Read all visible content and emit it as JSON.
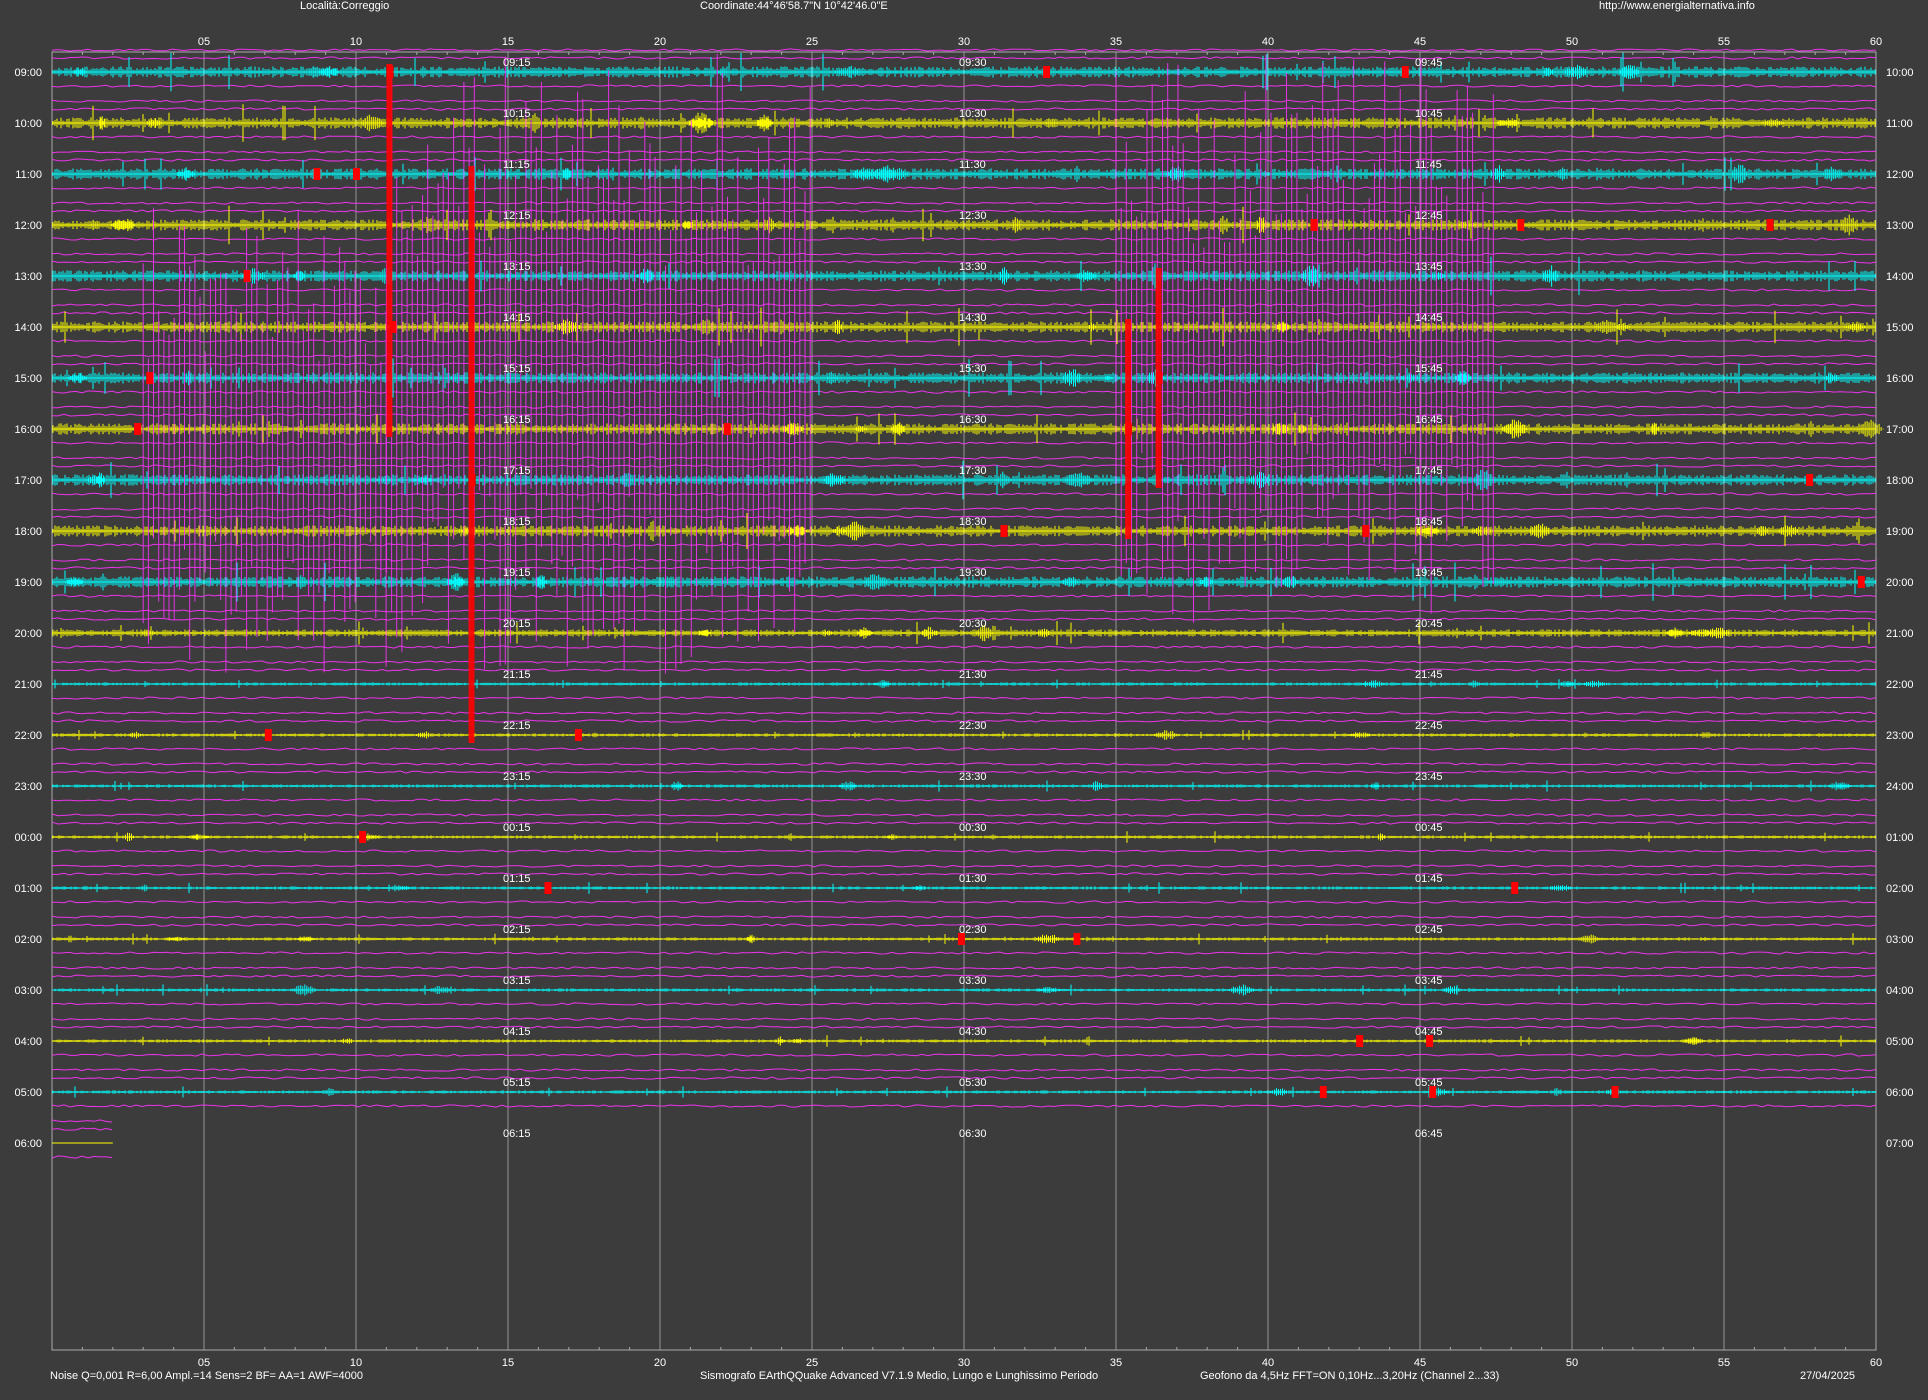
{
  "header": {
    "location": "Località:Correggio",
    "coordinates": "Coordinate:44°46'58.7\"N  10°42'46.0\"E",
    "url": "http://www.energialternativa.info"
  },
  "footer": {
    "settings": "Noise Q=0,001 R=6,00 Ampl.=14 Sens=2 BF= AA=1 AWF=4000",
    "software": "Sismografo  EArthQQuake Advanced V7.1.9  Medio, Lungo e Lunghissimo Periodo",
    "sensor": "Geofono da 4,5Hz FFT=ON 0,10Hz...3,20Hz     (Channel 2...33)",
    "date": "27/04/2025"
  },
  "colors": {
    "background": "#3c3c3c",
    "trace_a": "#00ffff",
    "trace_b": "#ffff00",
    "event": "#ff0000",
    "long_period": "#ff33ff",
    "grid": "#aaaaaa"
  },
  "chart_data": {
    "type": "line",
    "xlabel": "",
    "ylabel": "",
    "xlim": [
      0,
      60
    ],
    "x_ticks": [
      "05",
      "10",
      "15",
      "20",
      "25",
      "30",
      "35",
      "40",
      "45",
      "50",
      "55",
      "60"
    ],
    "rows": [
      {
        "left": "09:00",
        "right": "10:00",
        "marks": [
          "09:15",
          "09:30",
          "09:45"
        ],
        "trace": "a",
        "activity": 3
      },
      {
        "left": "10:00",
        "right": "11:00",
        "marks": [
          "10:15",
          "10:30",
          "10:45"
        ],
        "trace": "b",
        "activity": 3
      },
      {
        "left": "11:00",
        "right": "12:00",
        "marks": [
          "11:15",
          "11:30",
          "11:45"
        ],
        "trace": "a",
        "activity": 3
      },
      {
        "left": "12:00",
        "right": "13:00",
        "marks": [
          "12:15",
          "12:30",
          "12:45"
        ],
        "trace": "b",
        "activity": 3
      },
      {
        "left": "13:00",
        "right": "14:00",
        "marks": [
          "13:15",
          "13:30",
          "13:45"
        ],
        "trace": "a",
        "activity": 3
      },
      {
        "left": "14:00",
        "right": "15:00",
        "marks": [
          "14:15",
          "14:30",
          "14:45"
        ],
        "trace": "b",
        "activity": 3
      },
      {
        "left": "15:00",
        "right": "16:00",
        "marks": [
          "15:15",
          "15:30",
          "15:45"
        ],
        "trace": "a",
        "activity": 3
      },
      {
        "left": "16:00",
        "right": "17:00",
        "marks": [
          "16:15",
          "16:30",
          "16:45"
        ],
        "trace": "b",
        "activity": 3
      },
      {
        "left": "17:00",
        "right": "18:00",
        "marks": [
          "17:15",
          "17:30",
          "17:45"
        ],
        "trace": "a",
        "activity": 3
      },
      {
        "left": "18:00",
        "right": "19:00",
        "marks": [
          "18:15",
          "18:30",
          "18:45"
        ],
        "trace": "b",
        "activity": 3
      },
      {
        "left": "19:00",
        "right": "20:00",
        "marks": [
          "19:15",
          "19:30",
          "19:45"
        ],
        "trace": "a",
        "activity": 3
      },
      {
        "left": "20:00",
        "right": "21:00",
        "marks": [
          "20:15",
          "20:30",
          "20:45"
        ],
        "trace": "b",
        "activity": 2
      },
      {
        "left": "21:00",
        "right": "22:00",
        "marks": [
          "21:15",
          "21:30",
          "21:45"
        ],
        "trace": "a",
        "activity": 1
      },
      {
        "left": "22:00",
        "right": "23:00",
        "marks": [
          "22:15",
          "22:30",
          "22:45"
        ],
        "trace": "b",
        "activity": 1
      },
      {
        "left": "23:00",
        "right": "24:00",
        "marks": [
          "23:15",
          "23:30",
          "23:45"
        ],
        "trace": "a",
        "activity": 1
      },
      {
        "left": "00:00",
        "right": "01:00",
        "marks": [
          "00:15",
          "00:30",
          "00:45"
        ],
        "trace": "b",
        "activity": 1
      },
      {
        "left": "01:00",
        "right": "02:00",
        "marks": [
          "01:15",
          "01:30",
          "01:45"
        ],
        "trace": "a",
        "activity": 1
      },
      {
        "left": "02:00",
        "right": "03:00",
        "marks": [
          "02:15",
          "02:30",
          "02:45"
        ],
        "trace": "b",
        "activity": 1
      },
      {
        "left": "03:00",
        "right": "04:00",
        "marks": [
          "03:15",
          "03:30",
          "03:45"
        ],
        "trace": "a",
        "activity": 1
      },
      {
        "left": "04:00",
        "right": "05:00",
        "marks": [
          "04:15",
          "04:30",
          "04:45"
        ],
        "trace": "b",
        "activity": 1
      },
      {
        "left": "05:00",
        "right": "06:00",
        "marks": [
          "05:15",
          "05:30",
          "05:45"
        ],
        "trace": "a",
        "activity": 1
      },
      {
        "left": "06:00",
        "right": "07:00",
        "marks": [
          "06:15",
          "06:30",
          "06:45"
        ],
        "trace": "b",
        "activity": 0
      }
    ],
    "long_period_bursts": [
      {
        "x_start": 3,
        "x_end": 11,
        "row_start": 3,
        "row_end": 12
      },
      {
        "x_start": 11,
        "x_end": 25,
        "row_start": 0,
        "row_end": 12
      },
      {
        "x_start": 35,
        "x_end": 47.5,
        "row_start": 0,
        "row_end": 11
      }
    ],
    "event_markers": [
      {
        "x": 10,
        "row": 2
      },
      {
        "x": 11.1,
        "row": 0
      },
      {
        "x": 32.7,
        "row": 0
      },
      {
        "x": 44.5,
        "row": 0
      },
      {
        "x": 8.7,
        "row": 2
      },
      {
        "x": 6.4,
        "row": 4
      },
      {
        "x": 11.2,
        "row": 5
      },
      {
        "x": 3.2,
        "row": 6
      },
      {
        "x": 2.8,
        "row": 7
      },
      {
        "x": 22.2,
        "row": 7
      },
      {
        "x": 13.8,
        "row": 8
      },
      {
        "x": 35.4,
        "row": 7
      },
      {
        "x": 36.4,
        "row": 6
      },
      {
        "x": 41.5,
        "row": 3
      },
      {
        "x": 48.3,
        "row": 3
      },
      {
        "x": 56.5,
        "row": 3
      },
      {
        "x": 57.8,
        "row": 8
      },
      {
        "x": 59.5,
        "row": 10
      },
      {
        "x": 31.3,
        "row": 9
      },
      {
        "x": 43.2,
        "row": 9
      },
      {
        "x": 17.3,
        "row": 13
      },
      {
        "x": 7.1,
        "row": 13
      },
      {
        "x": 10.2,
        "row": 15
      },
      {
        "x": 16.3,
        "row": 16
      },
      {
        "x": 48.1,
        "row": 16
      },
      {
        "x": 29.9,
        "row": 17
      },
      {
        "x": 33.7,
        "row": 17
      },
      {
        "x": 43,
        "row": 19
      },
      {
        "x": 45.3,
        "row": 19
      },
      {
        "x": 41.8,
        "row": 20
      },
      {
        "x": 51.4,
        "row": 20
      },
      {
        "x": 45.4,
        "row": 20
      }
    ]
  }
}
